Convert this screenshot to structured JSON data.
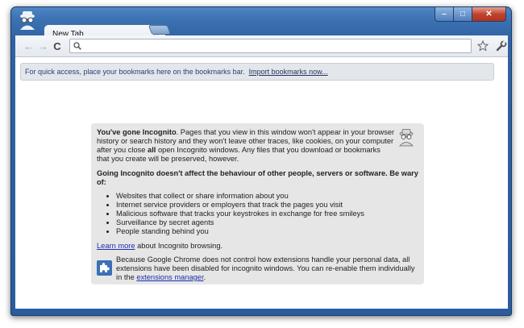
{
  "window": {
    "minimize_glyph": "–",
    "maximize_glyph": "□",
    "close_glyph": "✕"
  },
  "tabs": [
    {
      "title": "New Tab",
      "close_glyph": "×"
    }
  ],
  "toolbar": {
    "back_glyph": "←",
    "forward_glyph": "→",
    "reload_glyph": "C",
    "omnibox_value": "",
    "icons": [
      "back-icon",
      "forward-icon",
      "reload-icon",
      "search-icon",
      "star-icon",
      "wrench-icon"
    ]
  },
  "bookmark_bar": {
    "message": "For quick access, place your bookmarks here on the bookmarks bar.",
    "import_link": "Import bookmarks now..."
  },
  "incognito": {
    "intro_bold": "You've gone Incognito",
    "intro_rest_1": ". Pages that you view in this window won't appear in your browser history or search history and they won't leave other traces, like cookies, on your computer after you close ",
    "intro_all": "all",
    "intro_rest_2": " open Incognito windows. Any files that you download or bookmarks that you create will be preserved, however.",
    "warning": "Going Incognito doesn't affect the behaviour of other people, servers or software. Be wary of:",
    "list": [
      "Websites that collect or share information about you",
      "Internet service providers or employers that track the pages you visit",
      "Malicious software that tracks your keystrokes in exchange for free smileys",
      "Surveillance by secret agents",
      "People standing behind you"
    ],
    "learn_more_link": "Learn more",
    "learn_more_text": " about Incognito browsing.",
    "extensions_text": "Because Google Chrome does not control how extensions handle your personal data, all extensions have been disabled for incognito windows. You can re-enable them individually in the ",
    "extensions_link": "extensions manager",
    "extensions_end": "."
  }
}
